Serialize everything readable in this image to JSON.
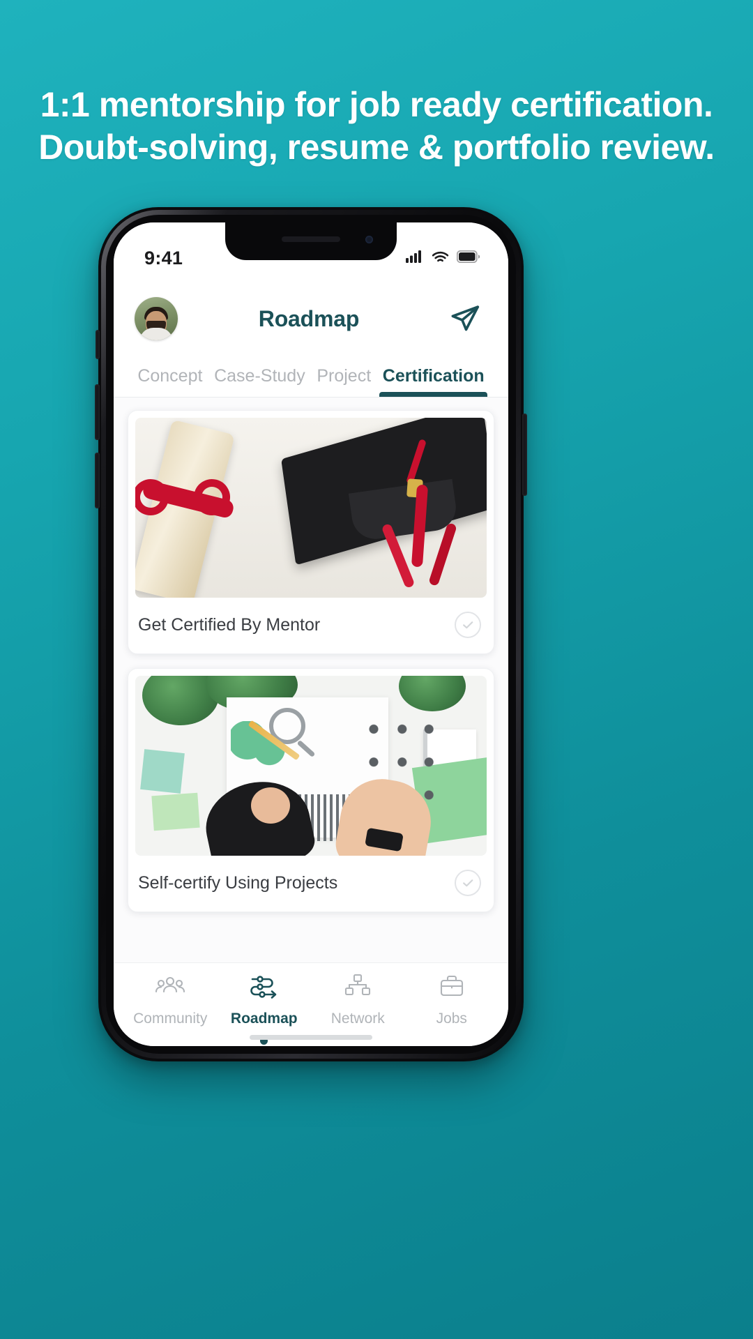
{
  "promo": {
    "headline_line1": "1:1 mentorship for job ready certification.",
    "headline_line2": "Doubt-solving, resume & portfolio review.",
    "background_color": "#17a6b0",
    "text_color": "#ffffff"
  },
  "status_bar": {
    "time": "9:41",
    "signal_icon": "cellular-signal-icon",
    "wifi_icon": "wifi-icon",
    "battery_icon": "battery-full-icon"
  },
  "app_header": {
    "title": "Roadmap",
    "avatar_icon": "user-avatar-photo",
    "send_icon": "send-paper-plane-icon",
    "accent_color": "#1b5158"
  },
  "tabs": {
    "items": [
      {
        "label": "Concept",
        "active": false
      },
      {
        "label": "Case-Study",
        "active": false
      },
      {
        "label": "Project",
        "active": false
      },
      {
        "label": "Certification",
        "active": true
      }
    ],
    "active_color": "#1b5158",
    "inactive_color": "#b1b4b8"
  },
  "cards": [
    {
      "label": "Get Certified By Mentor",
      "image_alt": "graduation-cap-and-diploma-photo",
      "status_icon": "check-circle-outline-icon",
      "completed": false
    },
    {
      "label": "Self-certify Using Projects",
      "image_alt": "team-working-on-desk-with-charts-photo",
      "status_icon": "check-circle-outline-icon",
      "completed": false
    }
  ],
  "bottom_nav": {
    "items": [
      {
        "label": "Community",
        "icon": "people-group-icon",
        "active": false
      },
      {
        "label": "Roadmap",
        "icon": "roadmap-path-icon",
        "active": true
      },
      {
        "label": "Network",
        "icon": "network-hierarchy-icon",
        "active": false
      },
      {
        "label": "Jobs",
        "icon": "briefcase-icon",
        "active": false
      }
    ],
    "active_color": "#1b5158",
    "inactive_color": "#b0b4b8"
  }
}
